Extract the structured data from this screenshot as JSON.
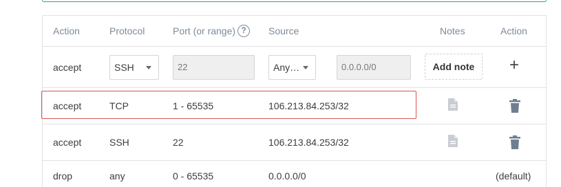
{
  "table": {
    "headers": {
      "action": "Action",
      "protocol": "Protocol",
      "port": "Port (or range)",
      "source": "Source",
      "notes": "Notes",
      "action2": "Action"
    },
    "help_glyph": "?",
    "new_rule": {
      "action": "accept",
      "protocol_selected": "SSH",
      "port_value": "22",
      "source_selected": "Any…",
      "source_ip": "0.0.0.0/0",
      "add_note_label": "Add note",
      "add_glyph": "+"
    },
    "rules": [
      {
        "action": "accept",
        "protocol": "TCP",
        "port": "1 - 65535",
        "source": "106.213.84.253/32"
      },
      {
        "action": "accept",
        "protocol": "SSH",
        "port": "22",
        "source": "106.213.84.253/32"
      },
      {
        "action": "drop",
        "protocol": "any",
        "port": "0 - 65535",
        "source": "0.0.0.0/0",
        "tag": "(default)"
      }
    ]
  },
  "icons": {
    "note": "note-icon",
    "trash": "trash-icon",
    "help": "help-icon"
  },
  "colors": {
    "header_text": "#7d8a99",
    "highlight": "#d9534f",
    "teal_panel": "#1aa7a3",
    "icon_muted": "#c9cdd2",
    "icon_trash": "#6f7f91"
  }
}
